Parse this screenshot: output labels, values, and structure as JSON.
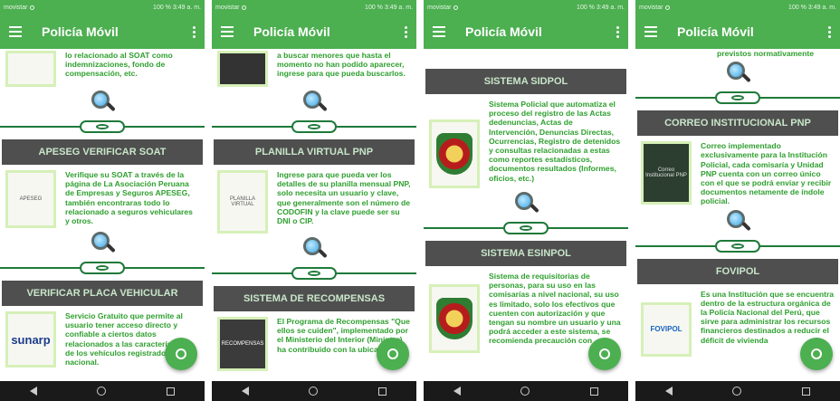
{
  "status_bar": {
    "carriers": [
      "movistar",
      "movistar",
      "movistar",
      "movistar"
    ],
    "battery": "100 %",
    "time": "3:49 a. m."
  },
  "app_bar": {
    "title": "Policía Móvil"
  },
  "screens": [
    {
      "top_text": "lo relacionado al SOAT como indemnizaciones, fondo de compensación, etc.",
      "top_thumb": "",
      "sections": [
        {
          "title": "APESEG VERIFICAR SOAT",
          "thumb": "APESEG",
          "text": "Verifique su SOAT a través de la página de La Asociación Peruana de Empresas y Seguros APESEG, también encontraras todo lo relacionado a seguros vehiculares y otros."
        },
        {
          "title": "VERIFICAR PLACA VEHICULAR",
          "thumb": "sunarp",
          "text": "Servicio Gratuito que permite al usuario tener acceso directo y confiable a ciertos datos relacionados a las características de los vehículos registrados a nivel nacional."
        }
      ]
    },
    {
      "top_text": "a buscar menores que hasta el momento no han podido aparecer, ingrese para que pueda buscarlos.",
      "top_thumb": "",
      "sections": [
        {
          "title": "PLANILLA VIRTUAL PNP",
          "thumb": "PLANILLA VIRTUAL",
          "text": "Ingrese para que pueda ver los detalles de su planilla mensual PNP, solo necesita un usuario y clave, que generalmente son el número de CODOFIN y la clave puede ser su DNI o CIP."
        },
        {
          "title": "SISTEMA DE RECOMPENSAS",
          "thumb": "RECOMPENSAS",
          "text": "El Programa de Recompensas \"Que ellos se cuiden\", implementado por el Ministerio del Interior (Mininter) ha contribuido con la ubicación"
        }
      ]
    },
    {
      "top_text": "",
      "top_thumb": "",
      "sections": [
        {
          "title": "SISTEMA SIDPOL",
          "thumb": "SIDPOL",
          "text": "Sistema Policial que automatiza el proceso del registro de las Actas dedenuncias, Actas de Intervención, Denuncias Directas, Ocurrencias, Registro de detenidos y consultas relacionadas a estas como reportes estadísticos, documentos resultados (Informes, oficios, etc.)"
        },
        {
          "title": "SISTEMA ESINPOL",
          "thumb": "ESINPOL",
          "text": "Sistema de requisitorias de personas, para su uso en las comisarías a nivel nacional, su uso es limitado, solo los efectivos que cuenten con autorización y que tengan su nombre un usuario y una podrá acceder a este sistema, se recomienda precaución con"
        }
      ]
    },
    {
      "top_text": "previstos normativamente",
      "top_thumb": "",
      "sections": [
        {
          "title": "CORREO INSTITUCIONAL PNP",
          "thumb": "Correo Institucional PNP",
          "text": "Correo implementado exclusivamente para la Institución Policial, cada comisaría y Unidad PNP cuenta con un correo único con el que se podrá enviar y recibir documentos netamente de índole policial."
        },
        {
          "title": "FOVIPOL",
          "thumb": "FOVIPOL",
          "text": "Es una Institución que se encuentra dentro de la estructura orgánica de la Policía Nacional del Perú, que sirve para administrar los recursos financieros destinados a reducir el déficit de vivienda"
        }
      ]
    }
  ]
}
